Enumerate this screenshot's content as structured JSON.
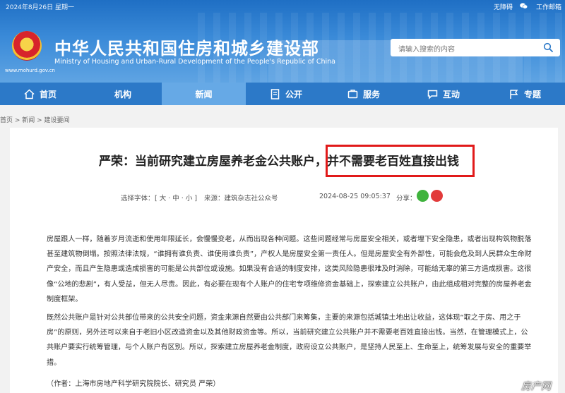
{
  "topbar": {
    "date": "2024年8月26日 星期一",
    "accessibility": "无障碍",
    "work_portal": "工作邮箱"
  },
  "site": {
    "title": "中华人民共和国住房和城乡建设部",
    "subtitle": "Ministry of Housing and Urban-Rural Development of the People's Republic of China",
    "domain": "www.mohurd.gov.cn"
  },
  "search": {
    "placeholder": "请输入搜索的内容"
  },
  "nav": {
    "items": [
      {
        "label": "首页",
        "icon": "home-icon"
      },
      {
        "label": "机构",
        "icon": ""
      },
      {
        "label": "新闻",
        "icon": "",
        "active": true
      },
      {
        "label": "公开",
        "icon": "document-icon"
      },
      {
        "label": "服务",
        "icon": "service-icon"
      },
      {
        "label": "互动",
        "icon": "chat-icon"
      },
      {
        "label": "专题",
        "icon": "flag-icon"
      }
    ]
  },
  "breadcrumb": "首页 > 新闻 > 建设要闻",
  "article": {
    "title_part1": "严荣：当前研究建立房屋养老金公共账户，",
    "title_part2": "并不需要老百姓直接出钱",
    "font_size_label": "选择字体：",
    "font_sizes": "[ 大 · 中 · 小 ]",
    "source": "来源：建筑杂志社公众号",
    "time": "2024-08-25 09:05:37",
    "share_label": "分享：",
    "paragraph1": "房屋跟人一样，随着岁月流逝和使用年限延长，会慢慢变老，从而出现各种问题。这些问题经常与房屋安全相关，或者埋下安全隐患，或者出现构筑物脱落甚至建筑物倒塌。按照法律法规，“谁拥有谁负责、谁使用谁负责”，产权人是房屋安全第一责任人。但是房屋安全有外部性，可能会危及到人民群众生命财产安全，而且产生隐患或造成损害的可能是公共部位或设施。如果没有合适的制度安排，这类风险隐患很难及时消除，可能给无辜的第三方造成损害。这很像“公地的悲剧”，有人受益，但无人尽责。因此，有必要在现有个人账户的住宅专项维修资金基础上，探索建立公共账户，由此组成相对完整的房屋养老金制度框架。",
    "paragraph2": "既然公共账户是针对公共部位带来的公共安全问题，资金来源自然要由公共部门来筹集，主要的来源包括城镇土地出让收益，这体现“取之于房、用之于房”的原则，另外还可以来自于老旧小区改造资金以及其他财政资金等。所以，当前研究建立公共账户并不需要老百姓直接出钱。当然，在管理模式上，公共账户要实行统筹管理，与个人账户有区别。所以，探索建立房屋养老金制度，政府设立公共账户，是坚持人民至上、生命至上，统筹发展与安全的重要举措。",
    "author": "（作者：上海市房地产科学研究院院长、研究员   严荣）"
  },
  "watermark": "房产网",
  "colors": {
    "header_blue": "#2c79c8",
    "nav_active": "#66a9e6",
    "highlight_border": "#e11a1a"
  }
}
